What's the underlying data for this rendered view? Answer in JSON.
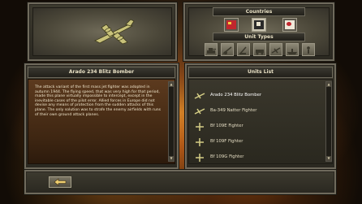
{
  "countries_title": "Countries",
  "unit_types_title": "Unit Types",
  "selected_unit_title": "Arado 234 Blitz Bomber",
  "units_list_title": "Units List",
  "description": "The attack variant of the first mass jet fighter was adopted in autumn 1944. The flying speed, that was very high for that period, made this plane virtually impossible to intercept, except in the inevitable cases of the pilot error. Allied forces in Europe did not devise any means of protection from the sudden attacks of this plane. The only solution was to strafe the enemy airfields with runs of their own ground attack planes.",
  "units": [
    {
      "name": "Arado 234 Blitz Bomber",
      "selected": true
    },
    {
      "name": "Ba-349 Natter Fighter",
      "selected": false
    },
    {
      "name": "Bf 109E Fighter",
      "selected": false
    },
    {
      "name": "Bf 109F Fighter",
      "selected": false
    },
    {
      "name": "Bf 109G Fighter",
      "selected": false
    }
  ],
  "countries": [
    "soviet-flag-icon",
    "german-flag-icon",
    "japanese-flag-icon"
  ],
  "unit_types": [
    "tank-icon",
    "artillery-icon",
    "anti-aircraft-icon",
    "armored-car-icon",
    "plane-icon",
    "ship-icon",
    "infantry-icon"
  ],
  "colors": {
    "header_text": "#e8e0c4",
    "desc_text": "#f0e6cc",
    "frame": "#6f6a5c",
    "fire": "#e08a28"
  }
}
